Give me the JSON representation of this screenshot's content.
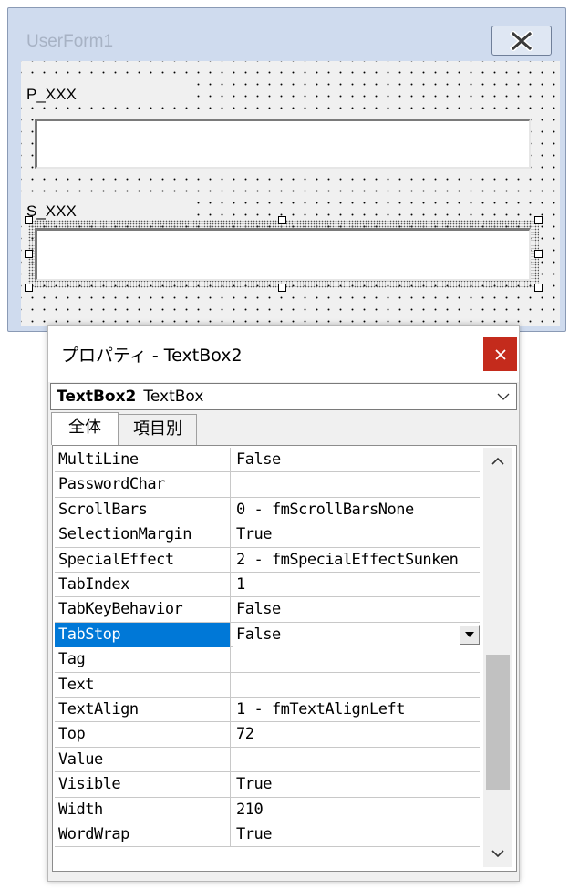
{
  "userform": {
    "title": "UserForm1",
    "label_p": "P_XXX",
    "label_s": "S_XXX"
  },
  "properties": {
    "title": "プロパティ - TextBox2",
    "object_name": "TextBox2",
    "object_type": "TextBox",
    "tabs": [
      "全体",
      "項目別"
    ],
    "scroll_position": 0.78,
    "rows": [
      {
        "name": "MultiLine",
        "value": "False"
      },
      {
        "name": "PasswordChar",
        "value": ""
      },
      {
        "name": "ScrollBars",
        "value": "0 - fmScrollBarsNone"
      },
      {
        "name": "SelectionMargin",
        "value": "True"
      },
      {
        "name": "SpecialEffect",
        "value": "2 - fmSpecialEffectSunken"
      },
      {
        "name": "TabIndex",
        "value": "1"
      },
      {
        "name": "TabKeyBehavior",
        "value": "False"
      },
      {
        "name": "TabStop",
        "value": "False",
        "selected": true
      },
      {
        "name": "Tag",
        "value": ""
      },
      {
        "name": "Text",
        "value": ""
      },
      {
        "name": "TextAlign",
        "value": "1 - fmTextAlignLeft"
      },
      {
        "name": "Top",
        "value": "72"
      },
      {
        "name": "Value",
        "value": ""
      },
      {
        "name": "Visible",
        "value": "True"
      },
      {
        "name": "Width",
        "value": "210"
      },
      {
        "name": "WordWrap",
        "value": "True"
      }
    ]
  },
  "colors": {
    "selection": "#0078d7",
    "close_button": "#c42b1c"
  },
  "icons": {
    "userform_close": "close-x-icon",
    "properties_close": "close-x-icon",
    "combo": "chevron-down-icon",
    "value_dropdown": "dropdown-arrow-icon",
    "scroll_up": "chevron-up-icon",
    "scroll_down": "chevron-down-icon"
  }
}
